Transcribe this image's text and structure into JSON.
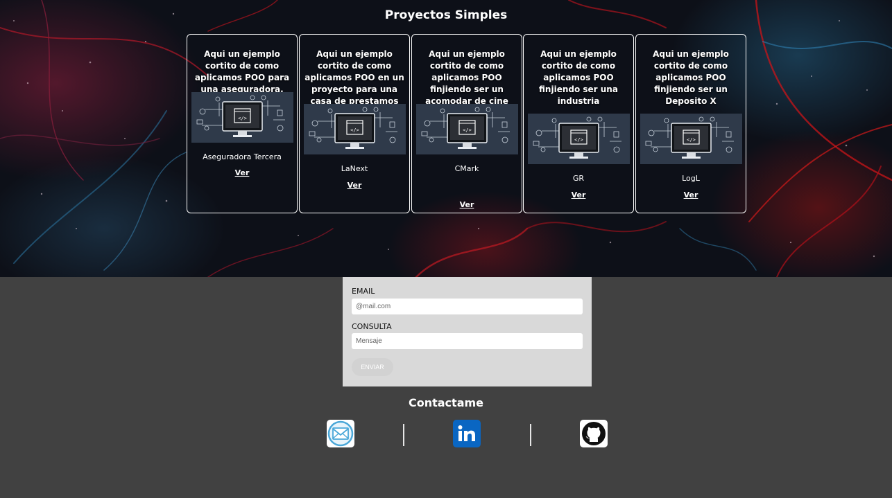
{
  "hero": {
    "title": "Proyectos Simples"
  },
  "projects": [
    {
      "description": "Aqui un ejemplo cortito de como aplicamos POO para una aseguradora.",
      "name": "Aseguradora Tercera",
      "link": "Ver",
      "image_icon": "computer-code-illustration"
    },
    {
      "description": "Aqui un ejemplo cortito de como aplicamos POO en un proyecto para una casa de prestamos",
      "name": "LaNext",
      "link": "Ver",
      "image_icon": "computer-code-illustration"
    },
    {
      "description": "Aqui un ejemplo cortito de como aplicamos POO finjiendo ser un acomodar de cine",
      "name": "CMark",
      "link": "Ver",
      "image_icon": "computer-code-illustration"
    },
    {
      "description": "Aqui un ejemplo cortito de como aplicamos POO finjiendo ser una industria",
      "name": "GR",
      "link": "Ver",
      "image_icon": "computer-code-illustration"
    },
    {
      "description": "Aqui un ejemplo cortito de como aplicamos POO finjiendo ser un Deposito X",
      "name": "LogL",
      "link": "Ver",
      "image_icon": "computer-code-illustration"
    }
  ],
  "form": {
    "email_label": "EMAIL",
    "email_placeholder": "@mail.com",
    "message_label": "CONSULTA",
    "message_placeholder": "Mensaje",
    "send_label": "ENVIAR"
  },
  "contact": {
    "title": "Contactame",
    "links": [
      {
        "icon": "mail-icon"
      },
      {
        "icon": "linkedin-icon"
      },
      {
        "icon": "github-icon"
      }
    ]
  },
  "colors": {
    "page_background": "#414141",
    "form_background": "#d9d9d9",
    "linkedin_blue": "#0a66c2",
    "hero_accent_red": "#c8141e",
    "hero_accent_blue": "#2f7fb0"
  }
}
